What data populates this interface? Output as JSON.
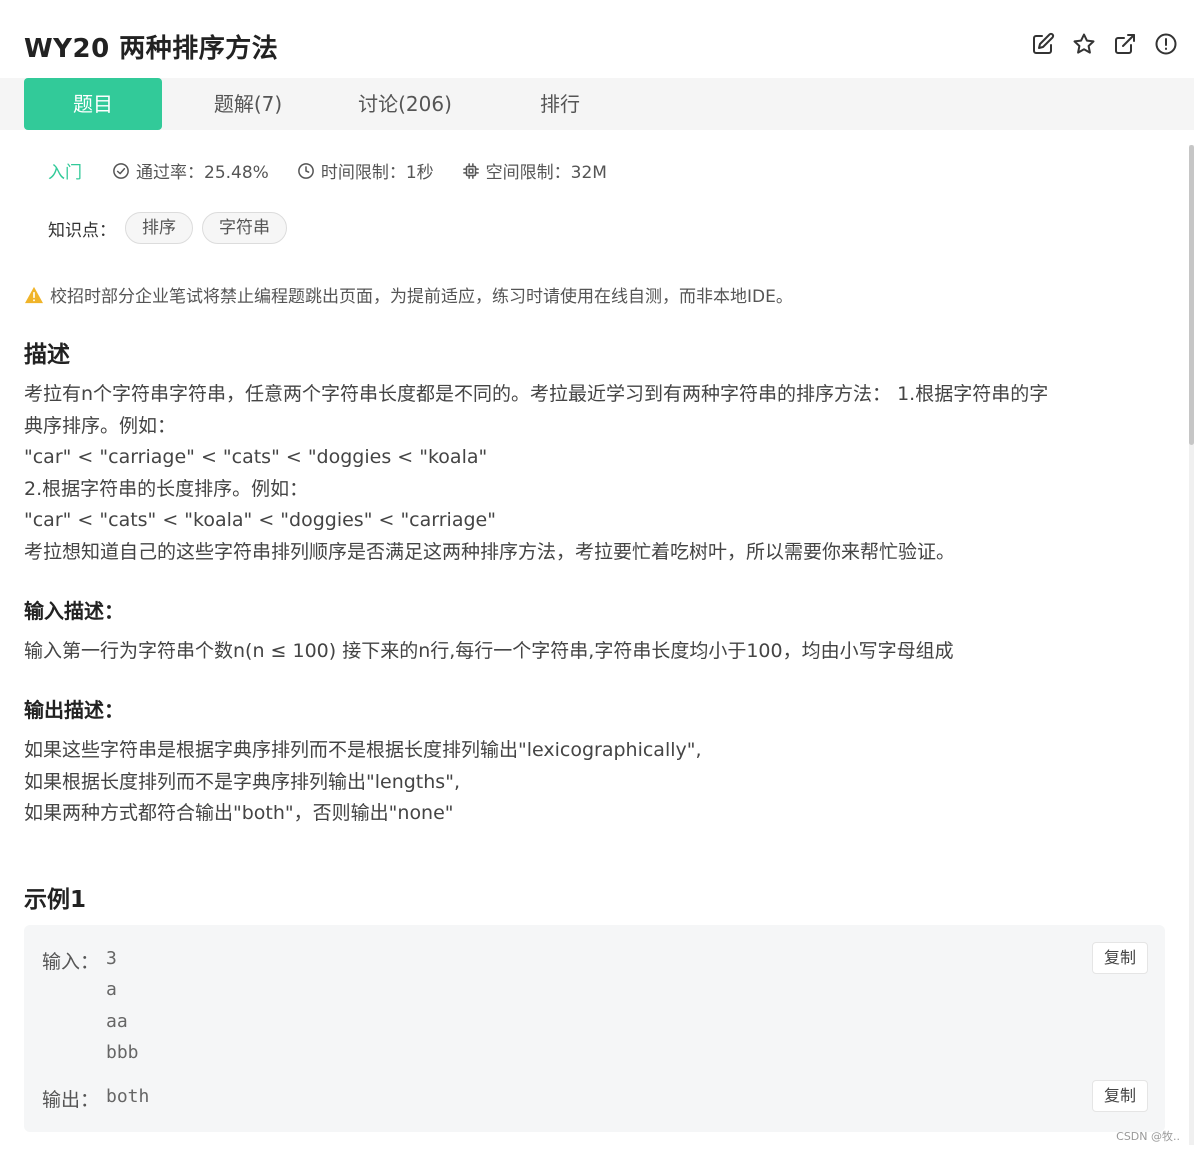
{
  "header": {
    "title": "WY20  两种排序方法"
  },
  "tabs": [
    {
      "label": "题目"
    },
    {
      "label": "题解(7)"
    },
    {
      "label": "讨论(206)"
    },
    {
      "label": "排行"
    }
  ],
  "meta": {
    "level": "入门",
    "pass_rate": "通过率：25.48%",
    "time_limit": "时间限制：1秒",
    "space_limit": "空间限制：32M"
  },
  "knowledge": {
    "label": "知识点：",
    "tags": [
      "排序",
      "字符串"
    ]
  },
  "warning": "校招时部分企业笔试将禁止编程题跳出页面，为提前适应，练习时请使用在线自测，而非本地IDE。",
  "description": {
    "heading": "描述",
    "lines": [
      "考拉有n个字符串字符串，任意两个字符串长度都是不同的。考拉最近学习到有两种字符串的排序方法： 1.根据字符串的字",
      "典序排序。例如：",
      "\"car\" < \"carriage\" < \"cats\" < \"doggies < \"koala\"",
      "2.根据字符串的长度排序。例如：",
      "\"car\" < \"cats\" < \"koala\" < \"doggies\" < \"carriage\"",
      "考拉想知道自己的这些字符串排列顺序是否满足这两种排序方法，考拉要忙着吃树叶，所以需要你来帮忙验证。"
    ]
  },
  "input_desc": {
    "heading": "输入描述：",
    "text": "输入第一行为字符串个数n(n ≤ 100) 接下来的n行,每行一个字符串,字符串长度均小于100，均由小写字母组成"
  },
  "output_desc": {
    "heading": "输出描述：",
    "lines": [
      "如果这些字符串是根据字典序排列而不是根据长度排列输出\"lexicographically\",",
      "如果根据长度排列而不是字典序排列输出\"lengths\",",
      "如果两种方式都符合输出\"both\"，否则输出\"none\""
    ]
  },
  "example": {
    "heading": "示例1",
    "input_label": "输入：",
    "input_value": "3\na\naa\nbbb",
    "output_label": "输出：",
    "output_value": "both",
    "copy_label": "复制"
  },
  "watermark": "CSDN @牧.."
}
